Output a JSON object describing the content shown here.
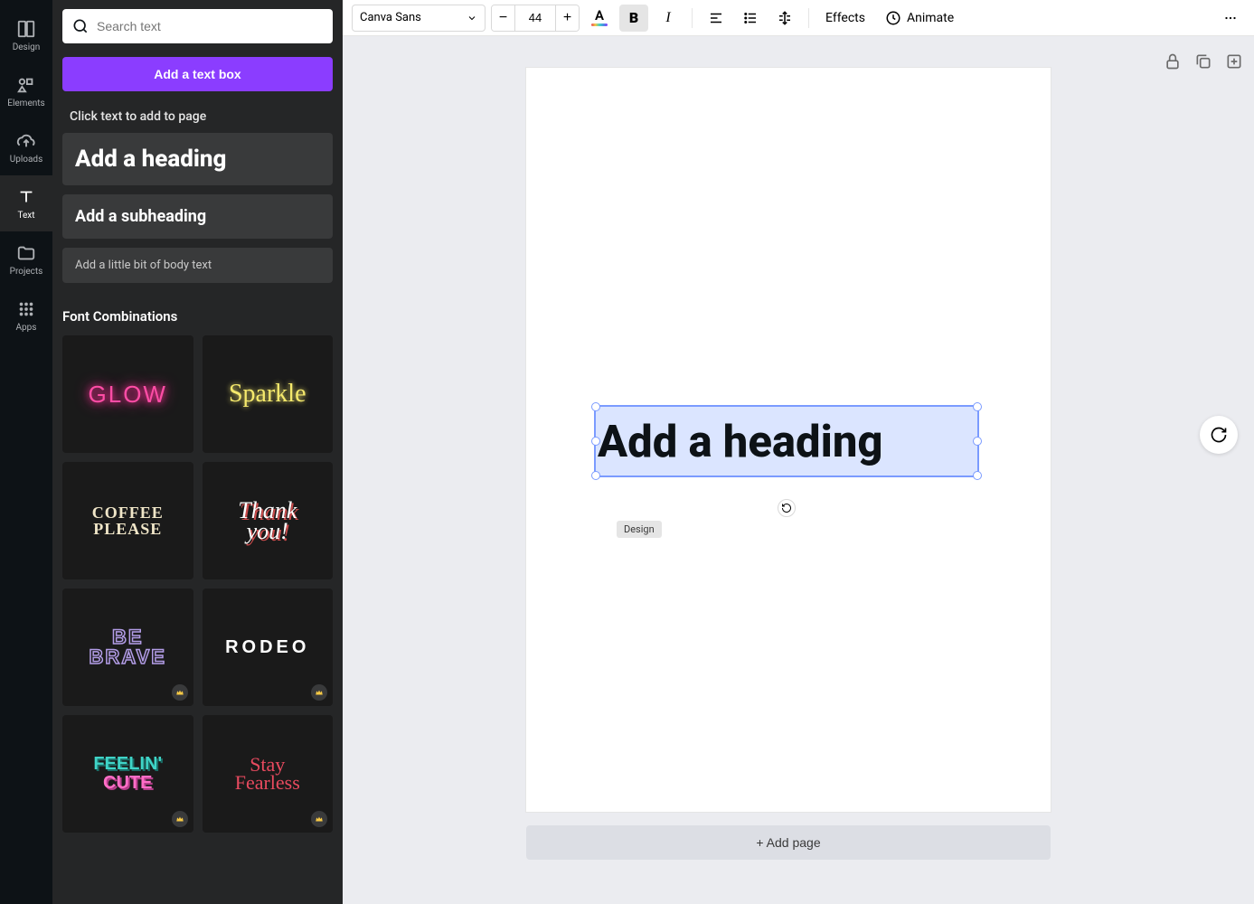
{
  "navrail": {
    "items": [
      {
        "key": "design",
        "label": "Design"
      },
      {
        "key": "elements",
        "label": "Elements"
      },
      {
        "key": "uploads",
        "label": "Uploads"
      },
      {
        "key": "text",
        "label": "Text"
      },
      {
        "key": "projects",
        "label": "Projects"
      },
      {
        "key": "apps",
        "label": "Apps"
      }
    ]
  },
  "sidepanel": {
    "search_placeholder": "Search text",
    "add_text_box": "Add a text box",
    "click_instruction": "Click text to add to page",
    "heading_label": "Add a heading",
    "subheading_label": "Add a subheading",
    "body_label": "Add a little bit of body text",
    "font_combinations_title": "Font Combinations",
    "combos": [
      {
        "key": "glow",
        "text": "GLOW",
        "premium": false
      },
      {
        "key": "sparkle",
        "text": "Sparkle",
        "premium": false
      },
      {
        "key": "coffee",
        "text": "COFFEE PLEASE",
        "premium": false
      },
      {
        "key": "thankyou",
        "text": "Thank you!",
        "premium": false
      },
      {
        "key": "brave",
        "text": "BE BRAVE",
        "premium": true
      },
      {
        "key": "rodeo",
        "text": "RODEO",
        "premium": true
      },
      {
        "key": "feelin",
        "text": "FEELIN' CUTE",
        "premium": true
      },
      {
        "key": "fearless",
        "text": "Stay Fearless",
        "premium": true
      }
    ]
  },
  "toolbar": {
    "font_name": "Canva Sans",
    "font_size": "44",
    "effects": "Effects",
    "animate": "Animate"
  },
  "canvas": {
    "text_content": "Add a heading",
    "tooltip": "Design",
    "add_page": "+ Add page"
  }
}
